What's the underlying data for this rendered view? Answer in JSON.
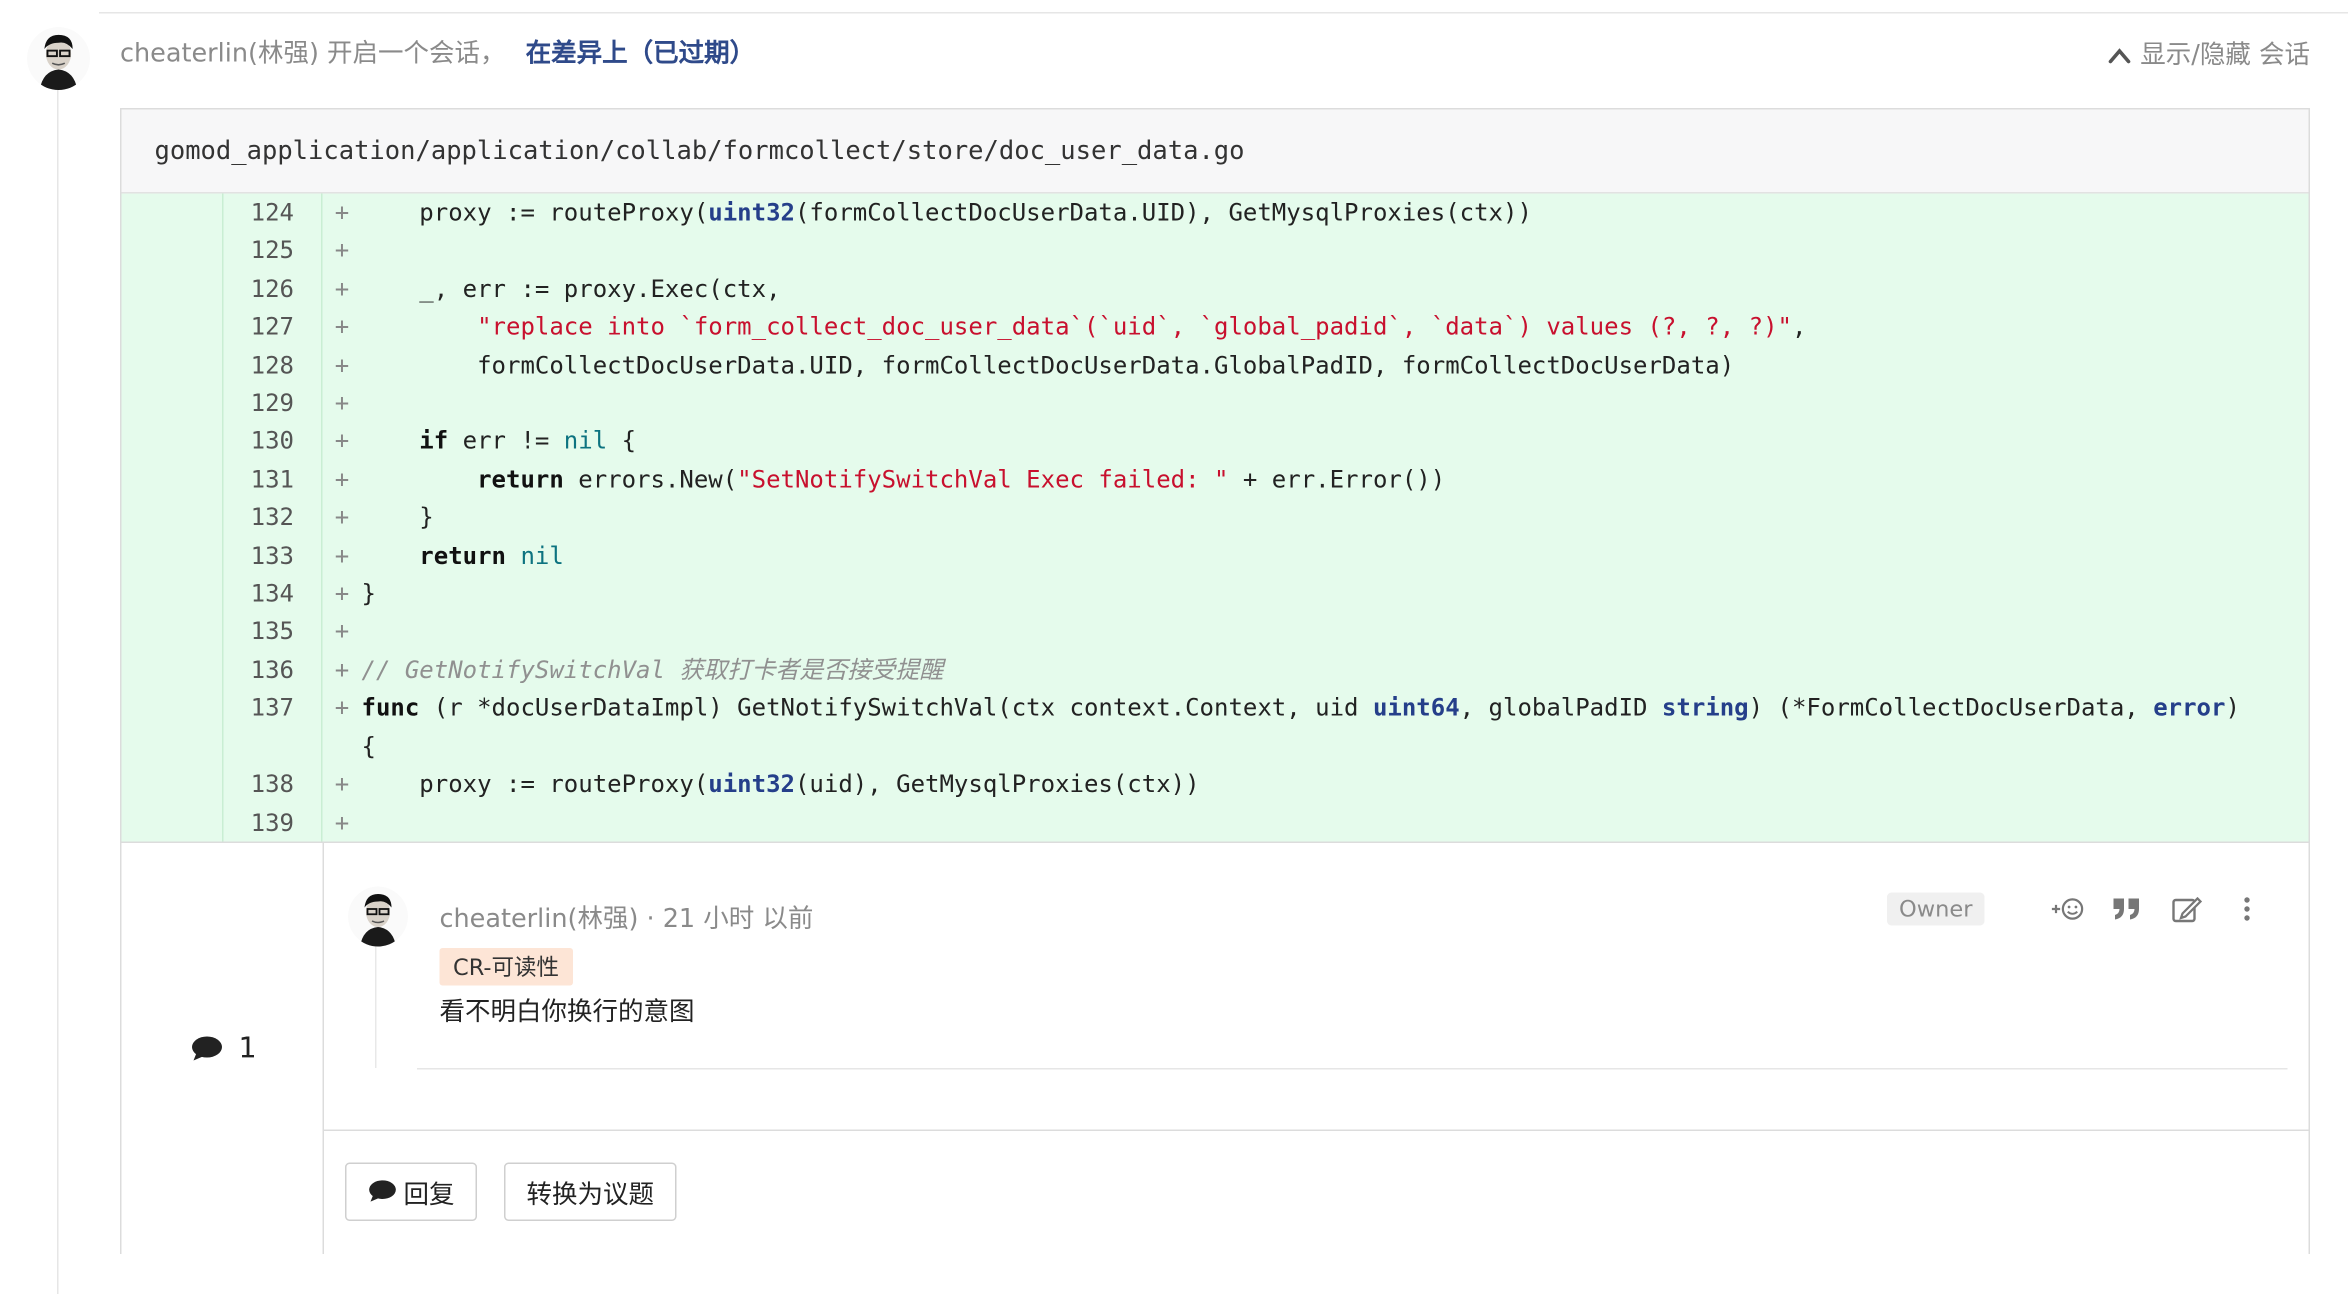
{
  "header": {
    "author": "cheaterlin(林强)",
    "action": "开启一个会话，",
    "link": "在差异上（已过期）",
    "toggle_label": "显示/隐藏 会话"
  },
  "file": {
    "path": "gomod_application/application/collab/formcollect/store/doc_user_data.go"
  },
  "code_lines": [
    {
      "num": "124",
      "sign": "+"
    },
    {
      "num": "125",
      "sign": "+"
    },
    {
      "num": "126",
      "sign": "+"
    },
    {
      "num": "127",
      "sign": "+"
    },
    {
      "num": "128",
      "sign": "+"
    },
    {
      "num": "129",
      "sign": "+"
    },
    {
      "num": "130",
      "sign": "+"
    },
    {
      "num": "131",
      "sign": "+"
    },
    {
      "num": "132",
      "sign": "+"
    },
    {
      "num": "133",
      "sign": "+"
    },
    {
      "num": "134",
      "sign": "+"
    },
    {
      "num": "135",
      "sign": "+"
    },
    {
      "num": "136",
      "sign": "+"
    },
    {
      "num": "137",
      "sign": "+"
    },
    {
      "num": "138",
      "sign": "+"
    },
    {
      "num": "139",
      "sign": "+"
    }
  ],
  "code": {
    "l124": {
      "a": "    proxy := routeProxy(",
      "b": "uint32",
      "c": "(formCollectDocUserData.UID), GetMysqlProxies(ctx))"
    },
    "l126": "    _, err := proxy.Exec(ctx,",
    "l127": {
      "indent": "        ",
      "str": "\"replace into `form_collect_doc_user_data`(`uid`, `global_padid`, `data`) values (?, ?, ?)\"",
      "tail": ","
    },
    "l128": "        formCollectDocUserData.UID, formCollectDocUserData.GlobalPadID, formCollectDocUserData)",
    "l130": {
      "indent": "    ",
      "kw": "if",
      "mid": " err != ",
      "nil": "nil",
      "tail": " {"
    },
    "l131": {
      "indent": "        ",
      "kw": "return",
      "mid": " errors.New(",
      "str": "\"SetNotifySwitchVal Exec failed: \"",
      "tail": " + err.Error())"
    },
    "l132": "    }",
    "l133": {
      "indent": "    ",
      "kw": "return",
      "nil": "nil"
    },
    "l134": "}",
    "l136": "// GetNotifySwitchVal 获取打卡者是否接受提醒",
    "l137": {
      "kw": "func",
      "a": " (r *docUserDataImpl) GetNotifySwitchVal(ctx context.Context, uid ",
      "t1": "uint64",
      "b": ", globalPadID ",
      "t2": "string",
      "c": ") (*FormCollectDocUserData, ",
      "t3": "error",
      "d": ") {"
    },
    "l138": {
      "a": "    proxy := routeProxy(",
      "b": "uint32",
      "c": "(uid), GetMysqlProxies(ctx))"
    }
  },
  "discussion": {
    "count": "1",
    "note": {
      "author": "cheaterlin(林强) · 21 小时 以前",
      "role": "Owner",
      "label": "CR-可读性",
      "text": "看不明白你换行的意图"
    },
    "reply_button": "回复",
    "convert_button": "转换为议题"
  },
  "icons": {
    "toggle": "chevron-up-icon",
    "comment": "comment-icon",
    "emoji": "add-emoji-icon",
    "quote": "quote-icon",
    "edit": "edit-icon",
    "more": "more-vertical-icon"
  },
  "colors": {
    "added_bg": "#e5fbec",
    "link": "#2f4a8a",
    "keyword_type": "#253f8a",
    "string": "#c8102e",
    "nil": "#0d7380",
    "label_bg": "#fde5d6"
  }
}
